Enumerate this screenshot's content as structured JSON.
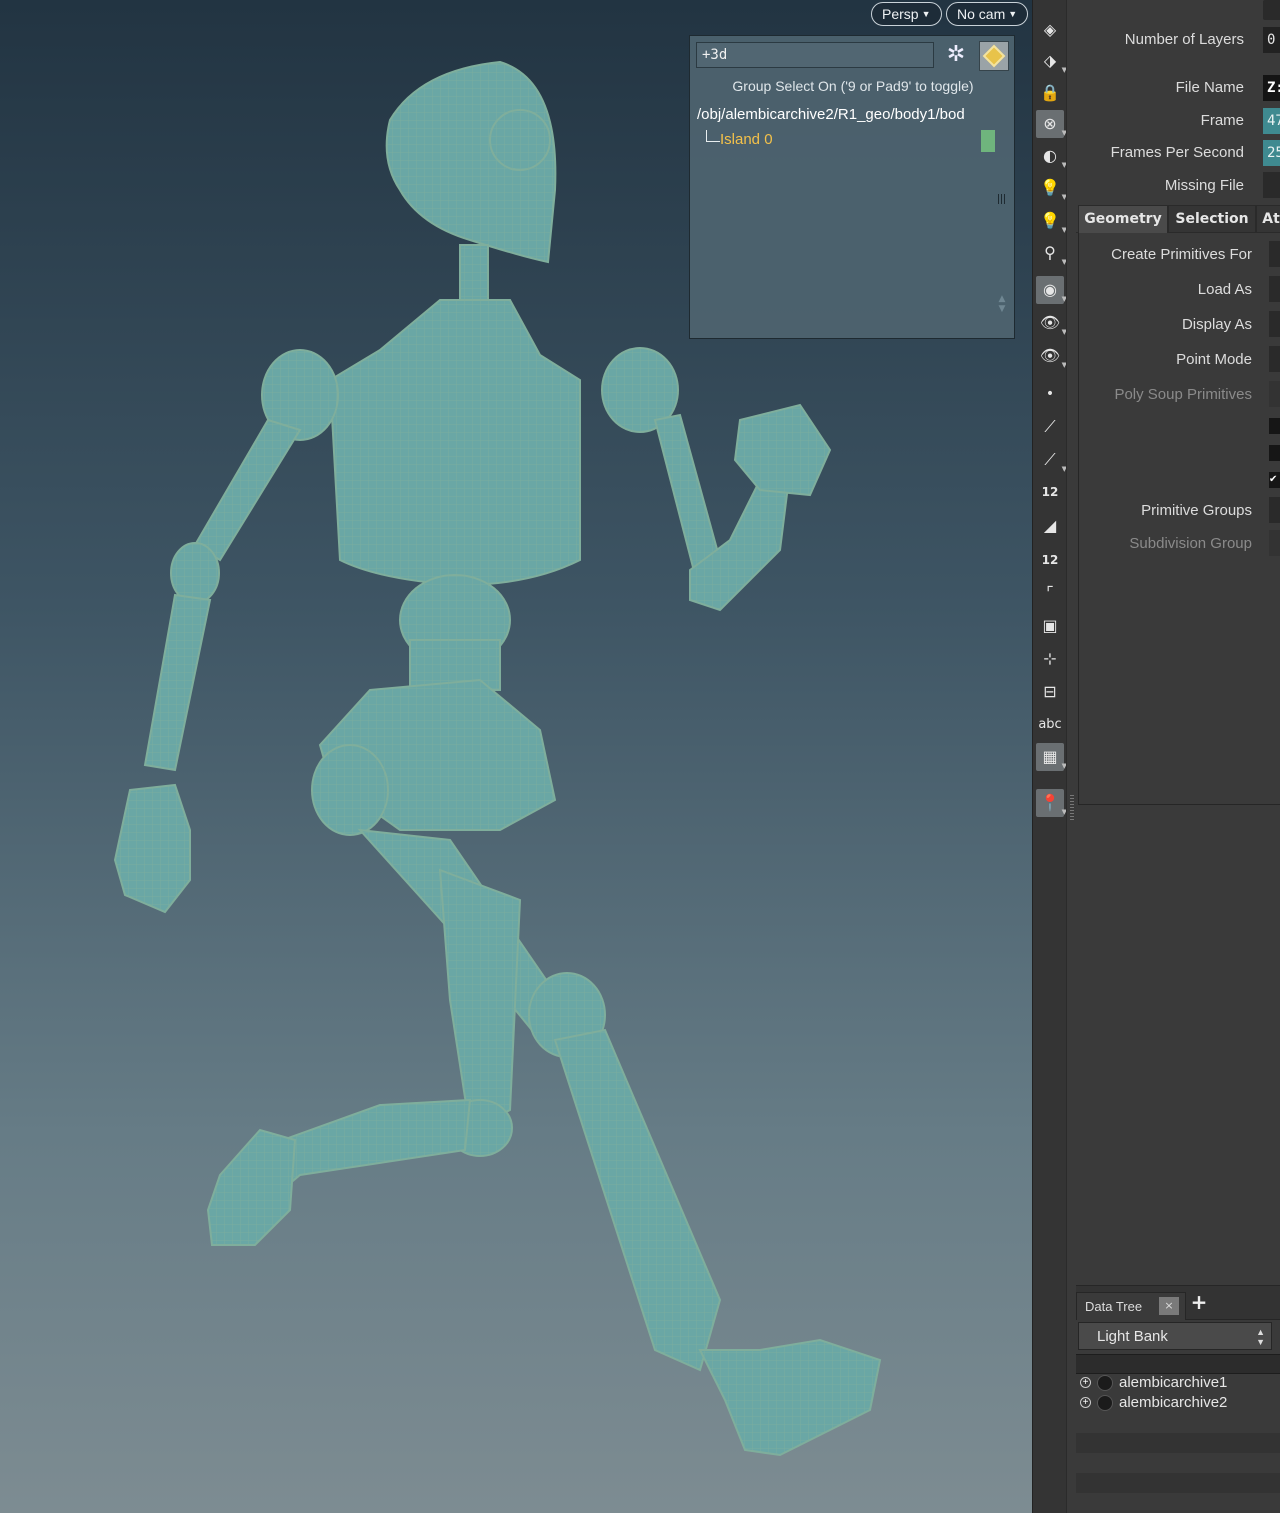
{
  "viewport": {
    "camera_label": "Persp",
    "cam_label": "No cam",
    "group_panel": {
      "input_value": "+3d",
      "hint": "Group Select On ('9 or Pad9' to toggle)",
      "path": "/obj/alembicarchive2/R1_geo/body1/bod",
      "island_label": "Island 0",
      "island_color": "#6fb47d"
    }
  },
  "shelf": {
    "tools": [
      {
        "icon": "display-options-icon",
        "glyph": "◈"
      },
      {
        "icon": "uv-layout-icon",
        "glyph": "⬗"
      },
      {
        "icon": "lock-icon",
        "glyph": "🔒"
      },
      {
        "icon": "ghost-other-objects-icon",
        "glyph": "⊗"
      },
      {
        "icon": "background-image-icon",
        "glyph": "◐"
      },
      {
        "icon": "light-bulb-icon",
        "glyph": "💡"
      },
      {
        "icon": "light-bulb-lit-icon",
        "glyph": "💡"
      },
      {
        "icon": "headlight-icon",
        "glyph": "⚲"
      },
      {
        "icon": "shading-mode-icon",
        "glyph": "◉"
      },
      {
        "icon": "visibility-eye-icon",
        "glyph": "👁"
      },
      {
        "icon": "hidden-eye-icon",
        "glyph": "👁"
      },
      {
        "icon": "point-display-icon",
        "glyph": "•"
      },
      {
        "icon": "point-normal-icon",
        "glyph": "⟋"
      },
      {
        "icon": "prim-normal-icon",
        "glyph": "⟋"
      },
      {
        "icon": "point-number-icon",
        "glyph": "12"
      },
      {
        "icon": "prim-display-icon",
        "glyph": "◢"
      },
      {
        "icon": "prim-number-icon",
        "glyph": "12"
      },
      {
        "icon": "curve-hull-icon",
        "glyph": "⌜"
      },
      {
        "icon": "vertex-display-icon",
        "glyph": "▣"
      },
      {
        "icon": "vertex-normal-icon",
        "glyph": "⊹"
      },
      {
        "icon": "uv-backface-icon",
        "glyph": "⊟"
      },
      {
        "icon": "text-abc-icon",
        "glyph": "abc"
      },
      {
        "icon": "image-view-icon",
        "glyph": "▦"
      },
      {
        "icon": "location-pin-icon",
        "glyph": "📍"
      }
    ]
  },
  "params": {
    "number_of_layers": {
      "label": "Number of Layers",
      "value": "0"
    },
    "file_name": {
      "label": "File Name",
      "value": "Z:"
    },
    "frame": {
      "label": "Frame",
      "value": "47"
    },
    "fps": {
      "label": "Frames Per Second",
      "value": "25"
    },
    "missing_file": {
      "label": "Missing File",
      "value": ""
    },
    "tabs": [
      "Geometry",
      "Selection",
      "At"
    ],
    "geometry": {
      "create_primitives_for": "Create Primitives For",
      "load_as": "Load As",
      "display_as": "Display As",
      "point_mode": "Point Mode",
      "poly_soup_primitives": "Poly Soup Primitives",
      "primitive_groups": "Primitive Groups",
      "subdivision_group": "Subdivision Group"
    }
  },
  "data_tree": {
    "tab_label": "Data Tree",
    "close_label": "×",
    "add_label": "+",
    "selector": "Light Bank",
    "items": [
      {
        "name": "alembicarchive1"
      },
      {
        "name": "alembicarchive2"
      }
    ]
  },
  "colors": {
    "robot_fill": "#6aa7a5",
    "robot_wire": "#86b39a",
    "viewport_top": "#223442",
    "viewport_bottom": "#7d8c92",
    "param_teal": "#3f8a90"
  }
}
